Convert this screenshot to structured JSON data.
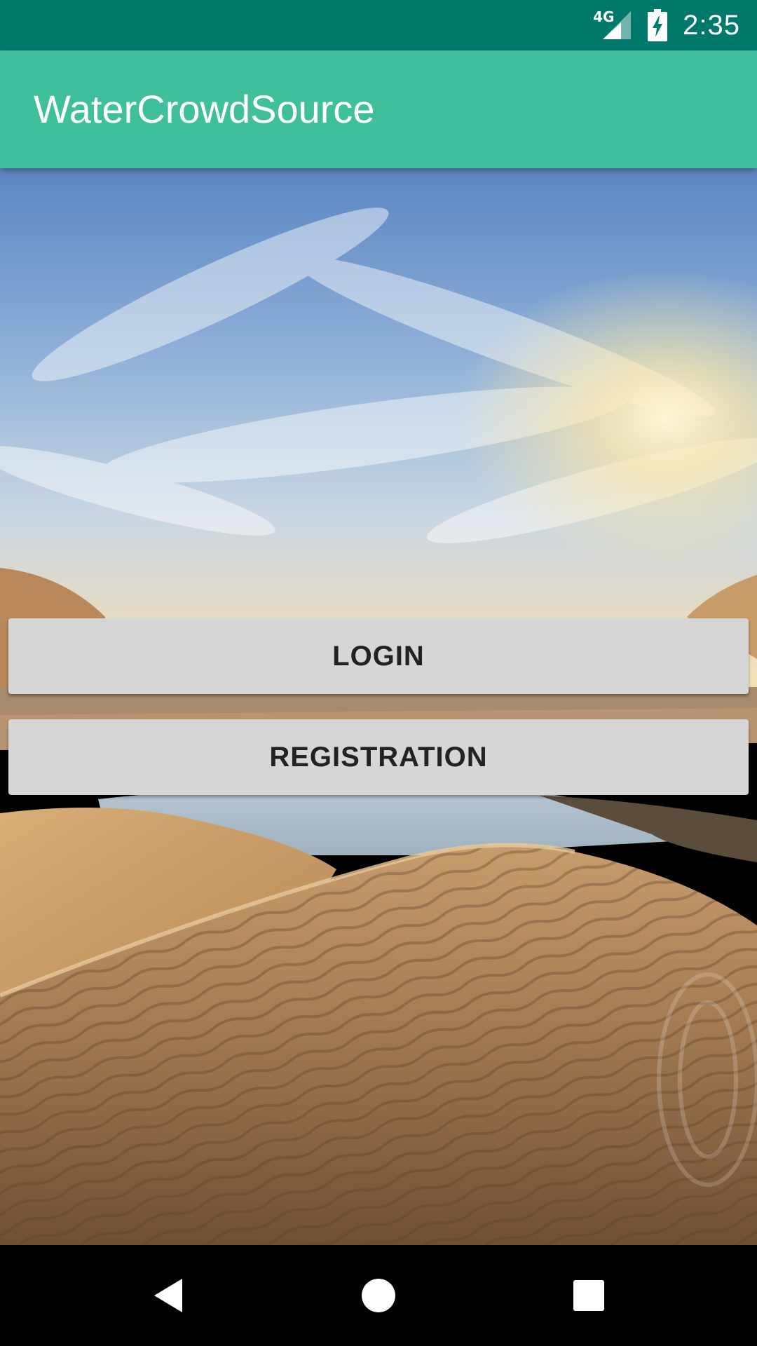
{
  "status_bar": {
    "network": "4G",
    "time": "2:35",
    "icons": [
      "signal-icon",
      "battery-charging-icon"
    ]
  },
  "app_bar": {
    "title": "WaterCrowdSource"
  },
  "main": {
    "background": "desert-dunes-oasis-image",
    "login_label": "LOGIN",
    "registration_label": "REGISTRATION"
  },
  "nav_bar": {
    "icons": [
      "back-icon",
      "home-icon",
      "recents-icon"
    ]
  },
  "colors": {
    "status_bar": "#00796b",
    "app_bar": "#3fbf9c",
    "button_bg": "#d6d6d6",
    "button_text": "#222222"
  }
}
